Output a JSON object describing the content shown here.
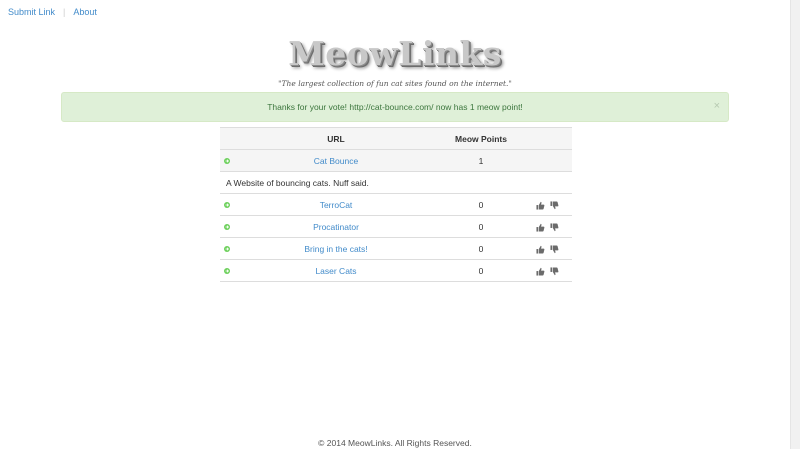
{
  "nav": {
    "submit_label": "Submit Link",
    "separator": "|",
    "about_label": "About"
  },
  "header": {
    "logo_text": "MeowLinks",
    "tagline": "\"The largest collection of fun cat sites found on the internet.\""
  },
  "alert": {
    "message": "Thanks for your vote! http://cat-bounce.com/ now has 1 meow point!",
    "close_label": "×"
  },
  "table": {
    "headers": {
      "url": "URL",
      "points": "Meow Points"
    },
    "rows": [
      {
        "name": "Cat Bounce",
        "points": "1",
        "description": "A Website of bouncing cats. Nuff said."
      },
      {
        "name": "TerroCat",
        "points": "0"
      },
      {
        "name": "Procatinator",
        "points": "0"
      },
      {
        "name": "Bring in the cats!",
        "points": "0"
      },
      {
        "name": "Laser Cats",
        "points": "0"
      }
    ]
  },
  "footer": {
    "text": "© 2014 MeowLinks. All Rights Reserved."
  },
  "colors": {
    "link": "#428bca",
    "go_icon": "#6cd05b",
    "alert_bg": "#dff0d8",
    "alert_text": "#3c763d",
    "vote_icon": "#6b6b6b"
  },
  "icons": {
    "go": "arrow-right-circle-icon",
    "up": "thumbs-up-icon",
    "down": "thumbs-down-icon"
  }
}
